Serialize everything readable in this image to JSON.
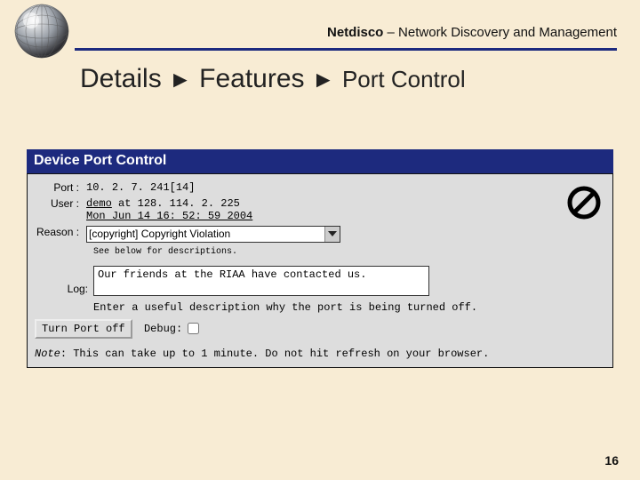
{
  "header": {
    "app": "Netdisco",
    "sep": " – ",
    "tagline": "Network Discovery and Management"
  },
  "breadcrumb": {
    "a": "Details",
    "b": "Features",
    "c": "Port Control",
    "arrow": "►"
  },
  "panel": {
    "title": "Device Port Control",
    "port_label": "Port :",
    "port_value": "10. 2. 7. 241[14]",
    "user_label": "User :",
    "user_name": "demo",
    "user_at": " at 128. 114. 2. 225",
    "user_time": "Mon Jun 14 16: 52: 59 2004",
    "reason_label": "Reason :",
    "reason_value": "[copyright] Copyright Violation",
    "desc_hint": "See below for descriptions.",
    "log_label": "Log:",
    "log_value": "Our friends at the RIAA have contacted us.",
    "log_hint": "Enter a useful description why the port is being turned off.",
    "button": "Turn Port off",
    "debug_label": "Debug:",
    "note_prefix": "Note",
    "note_text": ": This can take up to 1 minute. Do not hit refresh on your browser."
  },
  "page_number": "16"
}
